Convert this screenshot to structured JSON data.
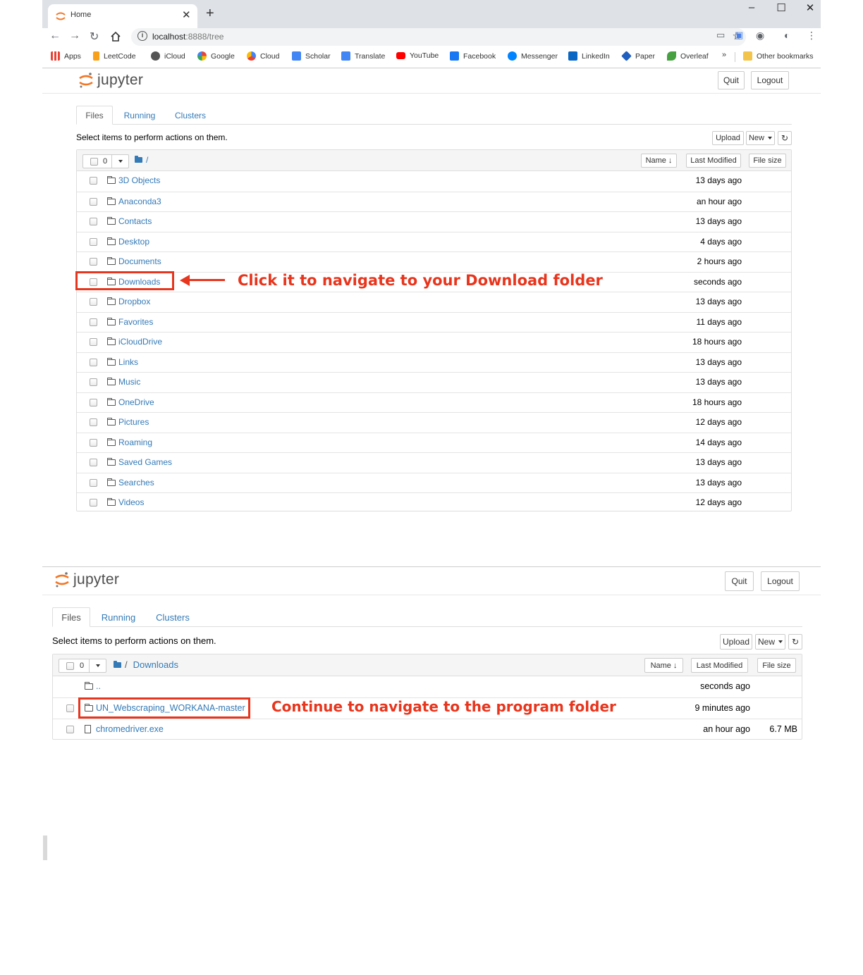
{
  "browser": {
    "tab_title": "Home",
    "url_host": "localhost",
    "url_rest": ":8888/tree",
    "bookmarks": [
      "Apps",
      "LeetCode",
      "iCloud",
      "Google",
      "Cloud",
      "Scholar",
      "Translate",
      "YouTube",
      "Facebook",
      "Messenger",
      "LinkedIn",
      "Paper",
      "Overleaf"
    ],
    "other_bookmarks": "Other bookmarks"
  },
  "jupyter": {
    "logo_text": "jupyter",
    "quit_label": "Quit",
    "logout_label": "Logout",
    "tabs": [
      "Files",
      "Running",
      "Clusters"
    ],
    "select_msg": "Select items to perform actions on them.",
    "upload_label": "Upload",
    "new_label": "New",
    "col_name": "Name",
    "col_modified": "Last Modified",
    "col_size": "File size",
    "selected_count": "0"
  },
  "screen1": {
    "path": "/",
    "rows": [
      {
        "name": "3D Objects",
        "modified": "13 days ago"
      },
      {
        "name": "Anaconda3",
        "modified": "an hour ago"
      },
      {
        "name": "Contacts",
        "modified": "13 days ago"
      },
      {
        "name": "Desktop",
        "modified": "4 days ago"
      },
      {
        "name": "Documents",
        "modified": "2 hours ago"
      },
      {
        "name": "Downloads",
        "modified": "seconds ago"
      },
      {
        "name": "Dropbox",
        "modified": "13 days ago"
      },
      {
        "name": "Favorites",
        "modified": "11 days ago"
      },
      {
        "name": "iCloudDrive",
        "modified": "18 hours ago"
      },
      {
        "name": "Links",
        "modified": "13 days ago"
      },
      {
        "name": "Music",
        "modified": "13 days ago"
      },
      {
        "name": "OneDrive",
        "modified": "18 hours ago"
      },
      {
        "name": "Pictures",
        "modified": "12 days ago"
      },
      {
        "name": "Roaming",
        "modified": "14 days ago"
      },
      {
        "name": "Saved Games",
        "modified": "13 days ago"
      },
      {
        "name": "Searches",
        "modified": "13 days ago"
      },
      {
        "name": "Videos",
        "modified": "12 days ago"
      }
    ],
    "annotation": "Click it to navigate to your Download folder"
  },
  "screen2": {
    "path_sep": "/",
    "path_folder": "Downloads",
    "rows": [
      {
        "name": "..",
        "modified": "seconds ago",
        "size": ""
      },
      {
        "name": "UN_Webscraping_WORKANA-master",
        "modified": "9 minutes ago",
        "size": ""
      },
      {
        "name": "chromedriver.exe",
        "modified": "an hour ago",
        "size": "6.7 MB"
      }
    ],
    "annotation": "Continue to navigate to the program folder"
  },
  "colors": {
    "link": "#337ab7",
    "annotation": "#e8351d",
    "jupyter_orange": "#f37726"
  }
}
